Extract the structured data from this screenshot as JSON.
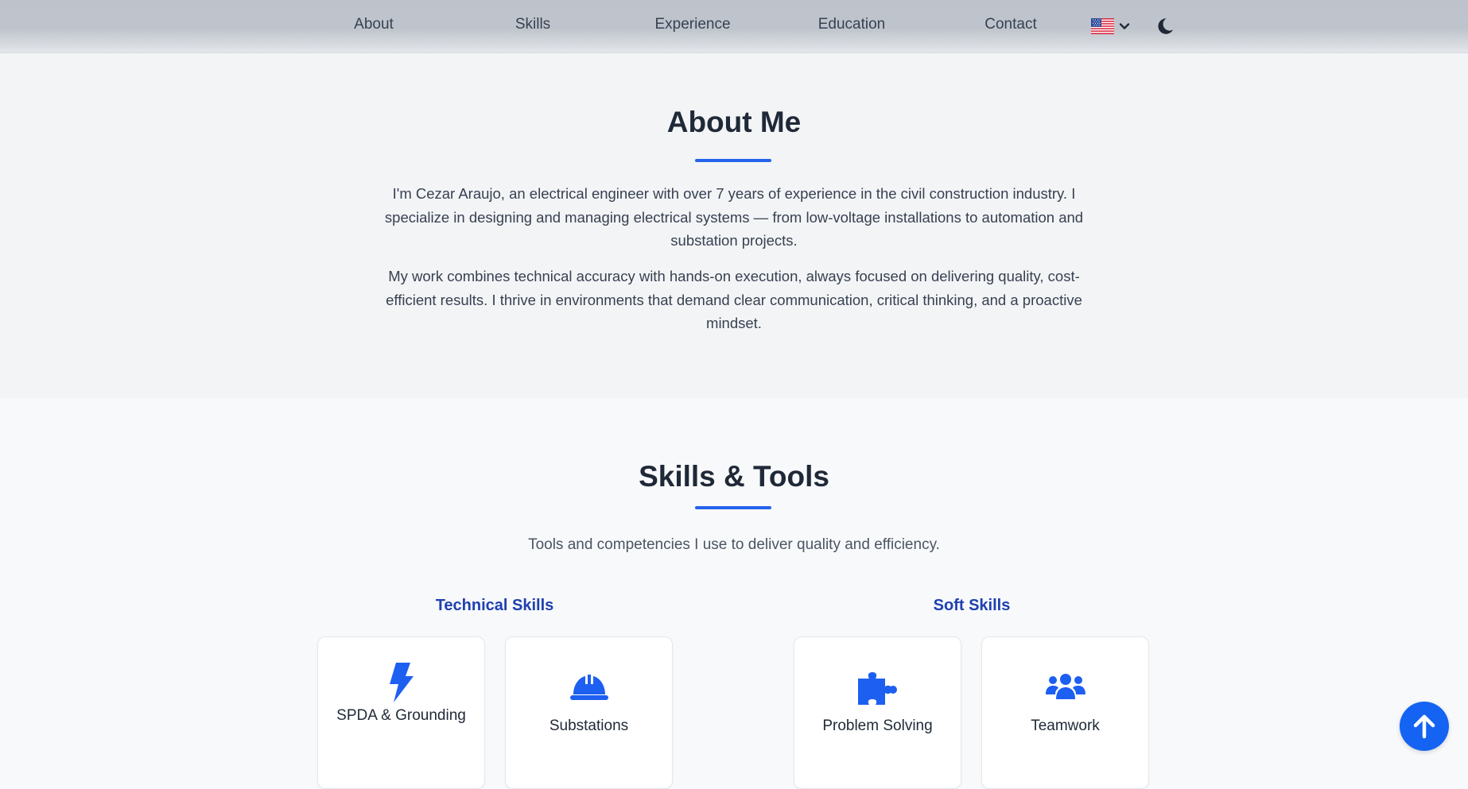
{
  "nav": {
    "links": [
      "About",
      "Skills",
      "Experience",
      "Education",
      "Contact"
    ],
    "language_icon": "us-flag-icon",
    "language_chevron_icon": "chevron-down-icon",
    "theme_icon": "moon-icon"
  },
  "about": {
    "title": "About Me",
    "paragraphs": [
      "I'm Cezar Araujo, an electrical engineer with over 7 years of experience in the civil construction industry. I specialize in designing and managing electrical systems — from low-voltage installations to automation and substation projects.",
      "My work combines technical accuracy with hands-on execution, always focused on delivering quality, cost-efficient results. I thrive in environments that demand clear communication, critical thinking, and a proactive mindset."
    ]
  },
  "skills": {
    "title": "Skills & Tools",
    "subtitle": "Tools and competencies I use to deliver quality and efficiency.",
    "technical": {
      "title": "Technical Skills",
      "items": [
        {
          "label": "SPDA & Grounding",
          "icon": "lightning-bolt-icon"
        },
        {
          "label": "Substations",
          "icon": "hard-hat-icon"
        }
      ]
    },
    "soft": {
      "title": "Soft Skills",
      "items": [
        {
          "label": "Problem Solving",
          "icon": "puzzle-piece-icon"
        },
        {
          "label": "Teamwork",
          "icon": "people-group-icon"
        }
      ]
    }
  },
  "scroll_top_icon": "arrow-up-icon",
  "colors": {
    "accent": "#2563eb",
    "heading": "#1f2937",
    "subheading": "#1e40af",
    "icon": "#1d5ff0",
    "scroll_button": "#1463f3"
  }
}
